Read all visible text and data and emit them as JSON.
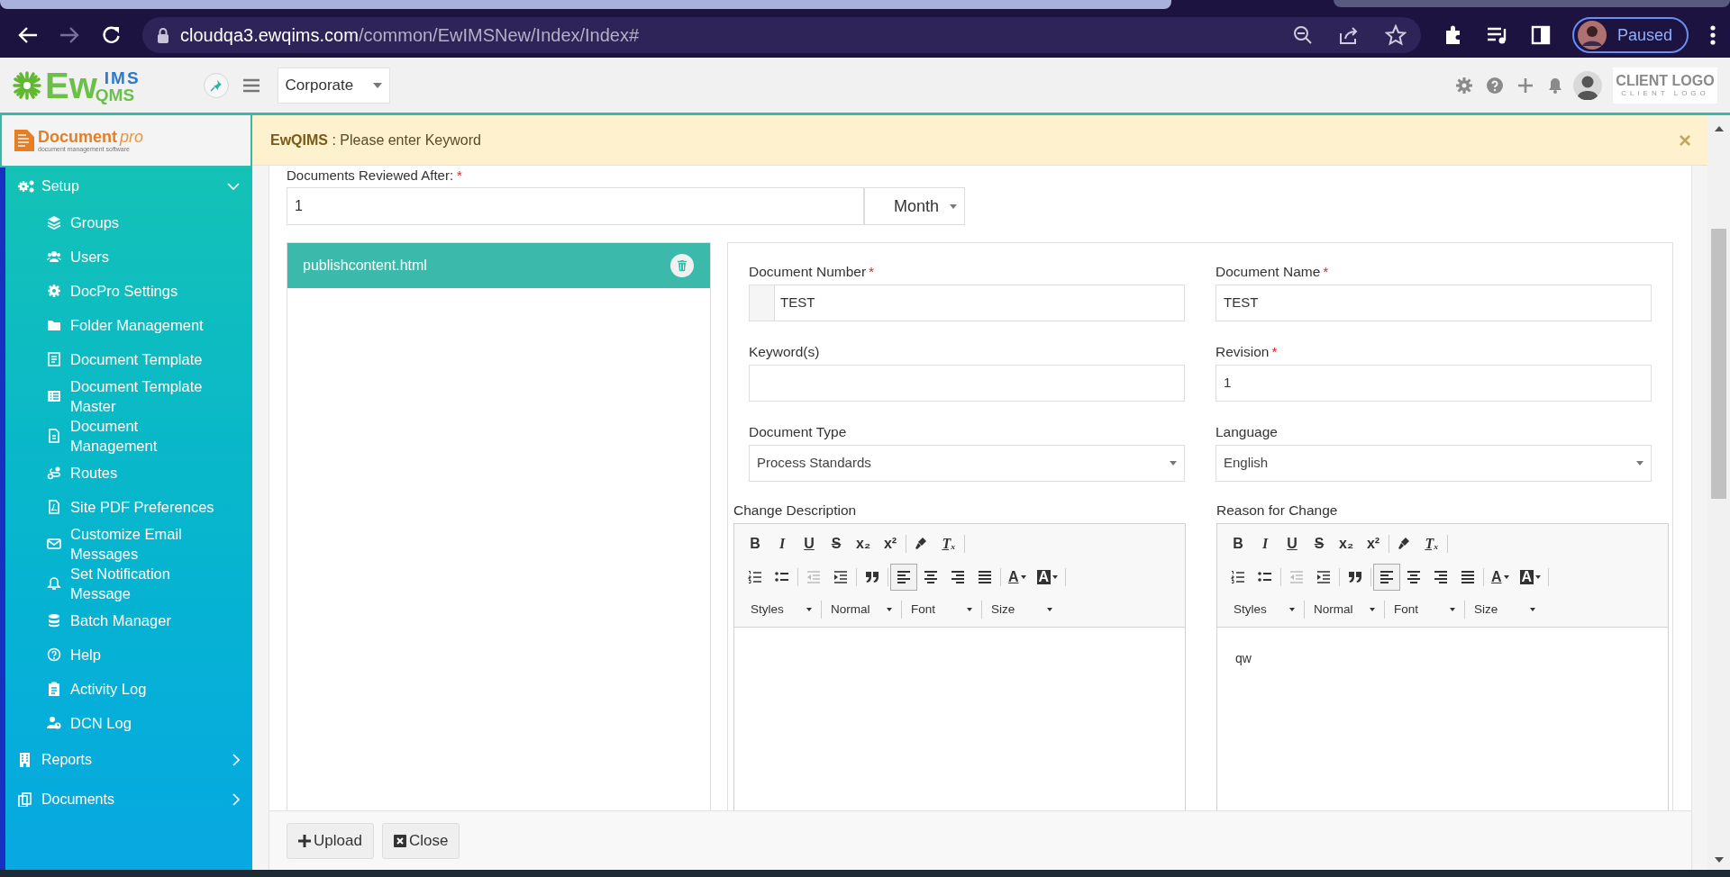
{
  "browser": {
    "url_host": "cloudqa3.ewqims.com",
    "url_path": "/common/EwIMSNew/Index/Index#",
    "profile_label": "Paused"
  },
  "header": {
    "logo": {
      "ew": "Ew",
      "ims": "IMS",
      "qms": "QMS"
    },
    "site_select": "Corporate",
    "client_logo": {
      "title": "CLIENT LOGO",
      "subtitle": "CLIENT LOGO"
    }
  },
  "sidebar": {
    "brand": {
      "name": "Document",
      "suffix": "pro",
      "tagline": "document management software"
    },
    "items": [
      {
        "label": "Setup",
        "expanded": true,
        "children": [
          {
            "label": "Groups"
          },
          {
            "label": "Users"
          },
          {
            "label": "DocPro Settings"
          },
          {
            "label": "Folder Management"
          },
          {
            "label": "Document Template"
          },
          {
            "label": "Document Template Master"
          },
          {
            "label": "Document Management"
          },
          {
            "label": "Routes"
          },
          {
            "label": "Site PDF Preferences"
          },
          {
            "label": "Customize Email Messages"
          },
          {
            "label": "Set Notification Message"
          },
          {
            "label": "Batch Manager"
          },
          {
            "label": "Help"
          },
          {
            "label": "Activity Log"
          },
          {
            "label": "DCN Log"
          }
        ]
      },
      {
        "label": "Reports",
        "expanded": false
      },
      {
        "label": "Documents",
        "expanded": false
      }
    ]
  },
  "alert": {
    "message": "**EwQIMS** : Please enter Keyword",
    "close": "×"
  },
  "review": {
    "label": "Documents Reviewed After:",
    "mark": "*",
    "value": "1",
    "unit": "Month"
  },
  "files": [
    {
      "name": "publishcontent.html",
      "selected": true
    }
  ],
  "fields": [
    {
      "label": "Document Number",
      "mark": "*",
      "kind": "addon-input",
      "value": "TEST"
    },
    {
      "label": "Document Name",
      "mark": "*",
      "kind": "input",
      "value": "TEST"
    },
    {
      "label": "Keyword(s)",
      "kind": "input"
    },
    {
      "label": "Revision",
      "mark": "*",
      "kind": "input",
      "value": "1"
    },
    {
      "label": "Document Type",
      "kind": "select",
      "value": "Process Standards"
    },
    {
      "label": "Language",
      "kind": "select",
      "value": "English"
    }
  ],
  "editors": [
    {
      "label": "Change Description",
      "rows": [
        [
          [
            {
              "kind": "bold",
              "label": "B",
              "disabled": false,
              "selected": false
            },
            {
              "kind": "italic",
              "label": "I",
              "disabled": false,
              "selected": false
            },
            {
              "kind": "underline",
              "label": "U",
              "disabled": false,
              "selected": false
            },
            {
              "kind": "strike",
              "label": "S",
              "disabled": false,
              "selected": false
            },
            {
              "kind": "sub",
              "label": "x₂",
              "disabled": false,
              "selected": false
            },
            {
              "kind": "sup",
              "label": "x²",
              "disabled": false,
              "selected": false
            }
          ],
          [
            {
              "kind": "paint",
              "disabled": false,
              "selected": false
            },
            {
              "kind": "clear",
              "label": "Tₓ",
              "disabled": false,
              "selected": false
            }
          ]
        ],
        [
          [
            {
              "kind": "ol",
              "disabled": false,
              "selected": false
            },
            {
              "kind": "ul",
              "disabled": false,
              "selected": false
            }
          ],
          [
            {
              "kind": "outdent",
              "disabled": true,
              "selected": false
            },
            {
              "kind": "indent",
              "disabled": false,
              "selected": false
            }
          ],
          [
            {
              "kind": "quote",
              "disabled": false,
              "selected": false
            }
          ],
          [
            {
              "kind": "left",
              "disabled": false,
              "selected": true
            },
            {
              "kind": "center",
              "disabled": false,
              "selected": false
            },
            {
              "kind": "right",
              "disabled": false,
              "selected": false
            },
            {
              "kind": "justify",
              "disabled": false,
              "selected": false
            }
          ],
          [
            {
              "kind": "textcolor",
              "label": "A",
              "disabled": false,
              "selected": false
            },
            {
              "kind": "bgcolor",
              "label": "A",
              "disabled": false,
              "selected": false
            }
          ]
        ]
      ],
      "combos": [
        "Styles",
        "Normal",
        "Font",
        "Size"
      ]
    },
    {
      "label": "Reason for Change",
      "rows": [
        [
          [
            {
              "kind": "bold",
              "label": "B",
              "disabled": false,
              "selected": false
            },
            {
              "kind": "italic",
              "label": "I",
              "disabled": false,
              "selected": false
            },
            {
              "kind": "underline",
              "label": "U",
              "disabled": false,
              "selected": false
            },
            {
              "kind": "strike",
              "label": "S",
              "disabled": false,
              "selected": false
            },
            {
              "kind": "sub",
              "label": "x₂",
              "disabled": false,
              "selected": false
            },
            {
              "kind": "sup",
              "label": "x²",
              "disabled": false,
              "selected": false
            }
          ],
          [
            {
              "kind": "paint",
              "disabled": false,
              "selected": false
            },
            {
              "kind": "clear",
              "label": "Tₓ",
              "disabled": false,
              "selected": false
            }
          ]
        ],
        [
          [
            {
              "kind": "ol",
              "disabled": false,
              "selected": false
            },
            {
              "kind": "ul",
              "disabled": false,
              "selected": false
            }
          ],
          [
            {
              "kind": "outdent",
              "disabled": true,
              "selected": false
            },
            {
              "kind": "indent",
              "disabled": false,
              "selected": false
            }
          ],
          [
            {
              "kind": "quote",
              "disabled": false,
              "selected": false
            }
          ],
          [
            {
              "kind": "left",
              "disabled": false,
              "selected": true
            },
            {
              "kind": "center",
              "disabled": false,
              "selected": false
            },
            {
              "kind": "right",
              "disabled": false,
              "selected": false
            },
            {
              "kind": "justify",
              "disabled": false,
              "selected": false
            }
          ],
          [
            {
              "kind": "textcolor",
              "label": "A",
              "disabled": false,
              "selected": false
            },
            {
              "kind": "bgcolor",
              "label": "A",
              "disabled": false,
              "selected": false
            }
          ]
        ]
      ],
      "combos": [
        "Styles",
        "Normal",
        "Font",
        "Size"
      ],
      "content": "qw"
    }
  ],
  "buttons": [
    {
      "label": "Upload",
      "kind": "upload"
    },
    {
      "label": "Close",
      "kind": "close"
    }
  ]
}
